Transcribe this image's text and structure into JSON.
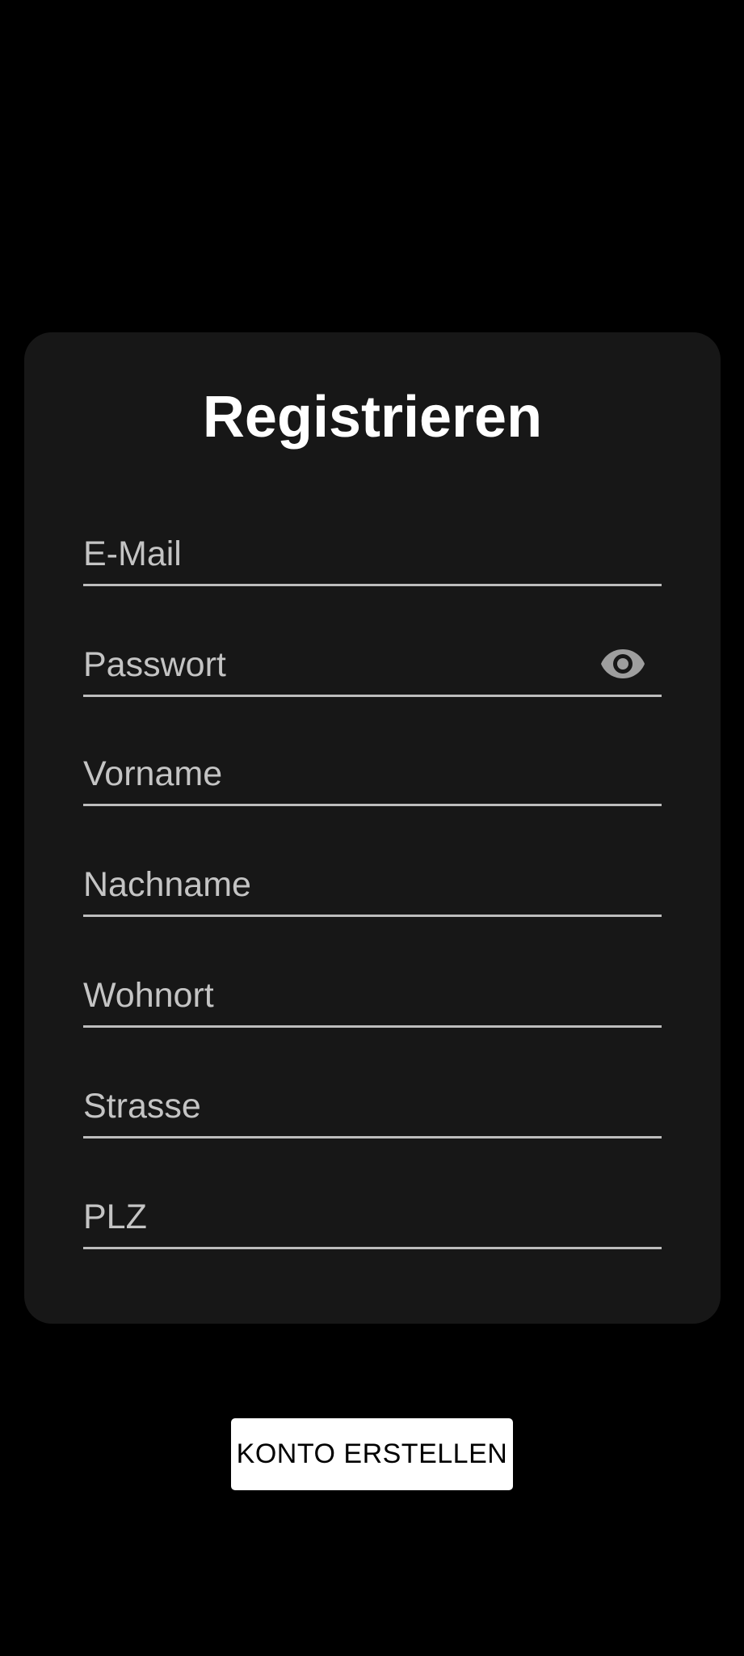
{
  "form": {
    "title": "Registrieren",
    "fields": [
      {
        "id": "email",
        "label": "E-Mail",
        "value": ""
      },
      {
        "id": "password",
        "label": "Passwort",
        "value": "",
        "trailing_icon": "eye-icon"
      },
      {
        "id": "firstname",
        "label": "Vorname",
        "value": ""
      },
      {
        "id": "lastname",
        "label": "Nachname",
        "value": ""
      },
      {
        "id": "city",
        "label": "Wohnort",
        "value": ""
      },
      {
        "id": "street",
        "label": "Strasse",
        "value": ""
      },
      {
        "id": "zip",
        "label": "PLZ",
        "value": ""
      }
    ]
  },
  "actions": {
    "create_account_label": "KONTO ERSTELLEN"
  },
  "colors": {
    "background": "#000000",
    "card": "#171717",
    "title": "#ffffff",
    "label": "#c4c4c4",
    "underline": "#bdbdbd",
    "icon": "#9e9e9e",
    "button_bg": "#ffffff",
    "button_text": "#000000"
  }
}
